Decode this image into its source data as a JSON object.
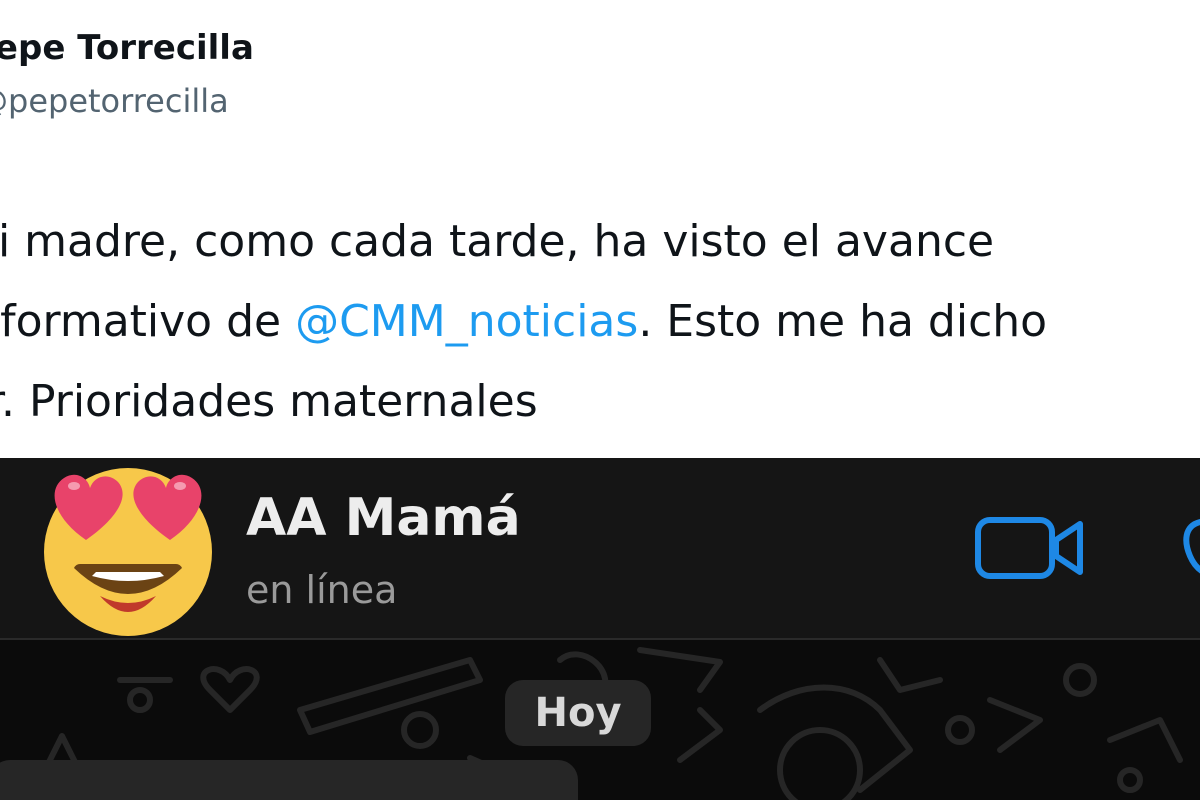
{
  "tweet": {
    "author_name": "Pepe Torrecilla",
    "author_handle": "@pepetorrecilla",
    "text_lines": [
      "Mi madre, como cada tarde, ha visto el avance",
      "informativo de ",
      ". Esto me ha dicho",
      "ar. Prioridades maternales"
    ],
    "mention": "@CMM_noticias"
  },
  "chat": {
    "contact_name": "AA Mamá",
    "status": "en línea",
    "date_label": "Hoy",
    "avatar_icon": "heart-eyes-emoji-icon",
    "header_icons": [
      "video-call-icon",
      "phone-call-icon"
    ],
    "colors": {
      "accent": "#1e88e5",
      "header_bg": "#151515",
      "bubble_bg": "#262626"
    }
  }
}
